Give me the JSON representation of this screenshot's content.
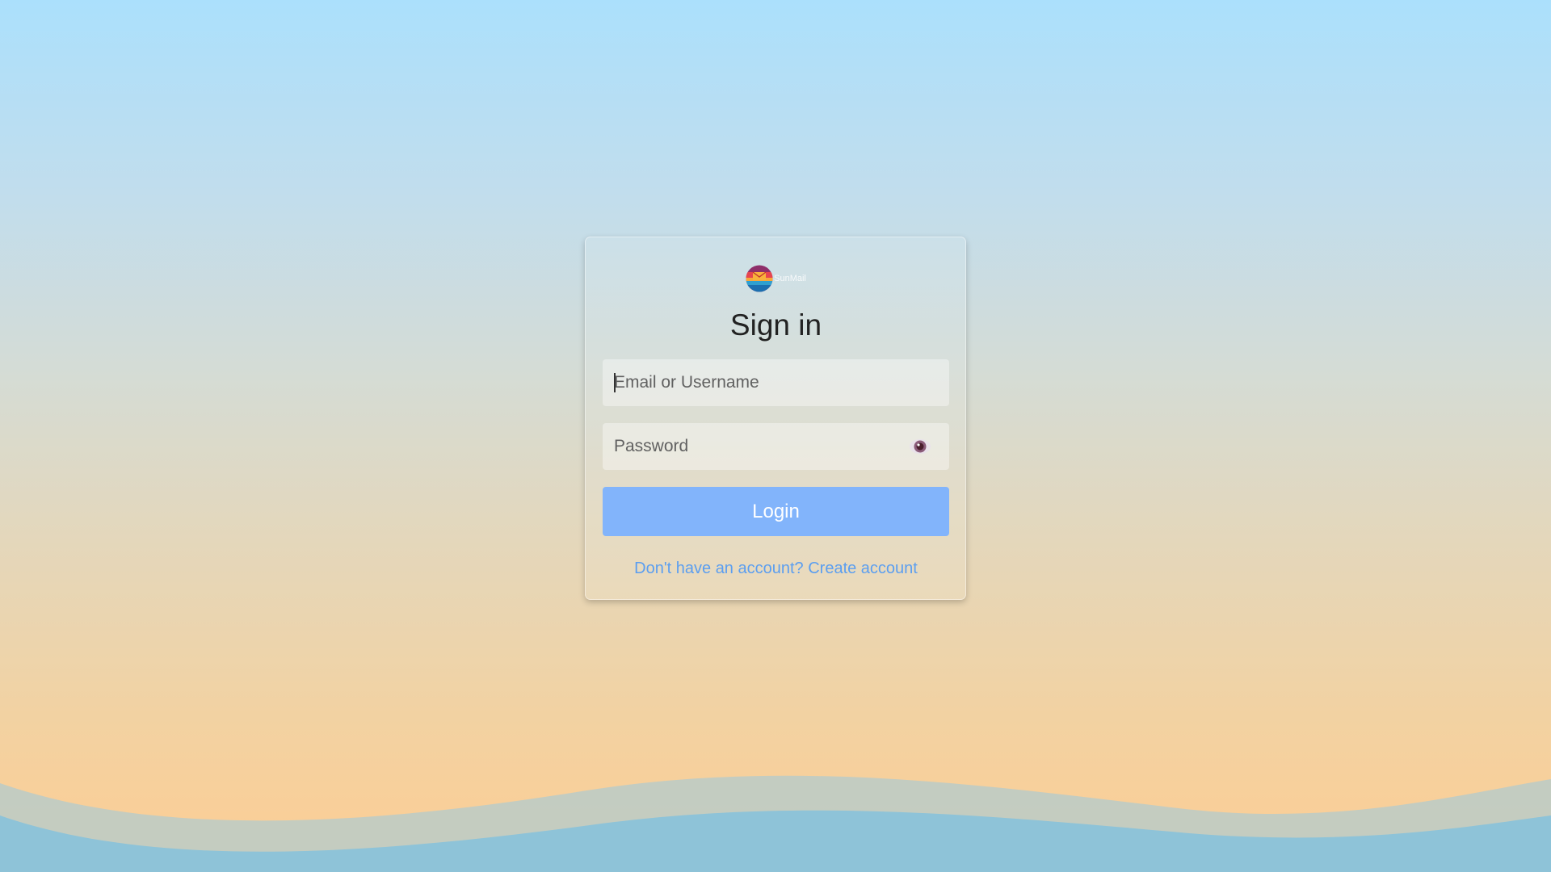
{
  "brand": {
    "name": "SunMail"
  },
  "login": {
    "title": "Sign in",
    "email_placeholder": "Email or Username",
    "password_placeholder": "Password",
    "login_label": "Login",
    "signup_text": "Don't have an account? Create account"
  },
  "icons": {
    "logo": "sunset-envelope-logo",
    "password_toggle": "eye-icon"
  },
  "colors": {
    "sky_top": "#abe0fc",
    "sand_bottom": "#fdcd94",
    "wave": "#8ec3d8",
    "login_button": "#82b4fb",
    "link": "#5b9ef0",
    "title_text": "#222222"
  }
}
